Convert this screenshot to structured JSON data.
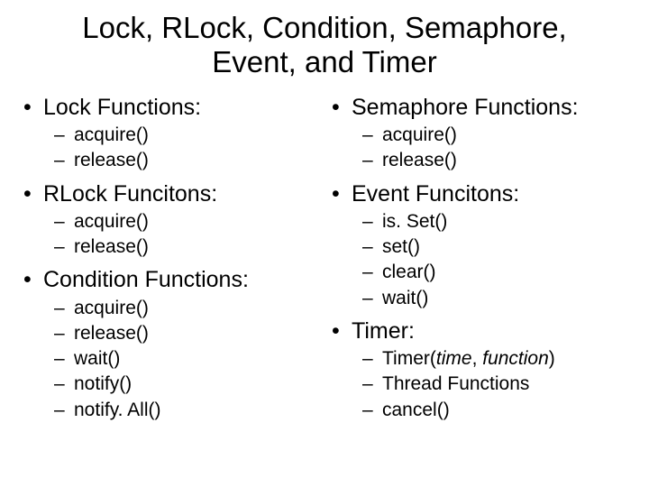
{
  "title": "Lock, RLock, Condition, Semaphore, Event, and Timer",
  "left": {
    "sections": [
      {
        "heading": "Lock Functions:",
        "items": [
          "acquire()",
          "release()"
        ]
      },
      {
        "heading": "RLock Funcitons:",
        "items": [
          "acquire()",
          "release()"
        ]
      },
      {
        "heading": "Condition Functions:",
        "items": [
          "acquire()",
          "release()",
          "wait()",
          "notify()",
          "notify. All()"
        ]
      }
    ]
  },
  "right": {
    "sections": [
      {
        "heading": "Semaphore Functions:",
        "items": [
          "acquire()",
          "release()"
        ]
      },
      {
        "heading": "Event Funcitons:",
        "items": [
          "is. Set()",
          "set()",
          "clear()",
          "wait()"
        ]
      },
      {
        "heading": "Timer:",
        "items": [
          "Timer(<i>time</i>, <i>function</i>)",
          "Thread Functions",
          "cancel()"
        ]
      }
    ]
  }
}
